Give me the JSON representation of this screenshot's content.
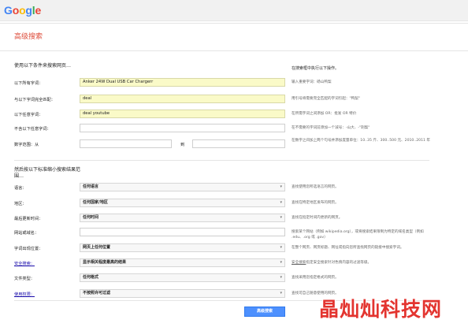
{
  "header": {
    "logo_letters": [
      {
        "ch": "G",
        "color": "#4285F4"
      },
      {
        "ch": "o",
        "color": "#EA4335"
      },
      {
        "ch": "o",
        "color": "#FBBC05"
      },
      {
        "ch": "g",
        "color": "#4285F4"
      },
      {
        "ch": "l",
        "color": "#34A853"
      },
      {
        "ch": "e",
        "color": "#EA4335"
      }
    ]
  },
  "page_title": "高级搜索",
  "section1": {
    "heading": "使用以下条件来搜索网页…",
    "hint_heading": "在搜索框中执行以下操作。",
    "rows": [
      {
        "label": "以下所有字词：",
        "value": "Anker 24W Dual USB Car Chargerr",
        "hint": "输入重要字词：砀山鸭梨"
      },
      {
        "label": "与以下字词完全匹配：",
        "value": "deal",
        "hint": "用引号将需要完全匹配的字词引起：\"鸭梨\""
      },
      {
        "label": "以下任意字词：",
        "value": "deal youtube",
        "hint": "在所需字词之间添加 OR：批发 OR 特价"
      },
      {
        "label": "不含以下任意字词：",
        "value": "",
        "hint": "在不需要的字词前添加一个减号：-山大、-\"刺梨\""
      }
    ],
    "range": {
      "label": "数字范围：从",
      "to": "到",
      "hint": "在数字之间加上两个句号并添加度量单位：10..35 斤、300..500 元、2010..2011 年"
    }
  },
  "section2": {
    "heading": "然后按以下标准缩小搜索结果范围…",
    "rows": [
      {
        "label": "语言：",
        "value": "任何语言",
        "hint": "查找使用您所选语言的网页。",
        "type": "select",
        "link": false
      },
      {
        "label": "地区：",
        "value": "任何国家/地区",
        "hint": "查找在特定地区发布的网页。",
        "type": "select",
        "link": false
      },
      {
        "label": "最后更新时间：",
        "value": "任何时间",
        "hint": "查找在指定时间内更新的网页。",
        "type": "select",
        "link": false
      },
      {
        "label": "网站或域名：",
        "value": "",
        "hint": "搜索某个网站（例如 wikipedia.org），或将搜索结果限制为特定的域名类型（例如 .edu、.org 或 .gov）",
        "type": "input",
        "link": false
      },
      {
        "label": "字词出现位置：",
        "value": "网页上任何位置",
        "hint": "在整个网页、网页标题、网址或指向您所查找网页的链接中搜索字词。",
        "type": "select",
        "link": false
      },
      {
        "label": "安全搜索：",
        "value": "显示相关程度最高的结果",
        "hint": "指定安全搜索针对色情内容的过滤等级。",
        "hint_link": "安全搜索",
        "type": "select",
        "link": true
      },
      {
        "label": "文件类型：",
        "value": "任何格式",
        "hint": "查找采用您指定格式的网页。",
        "type": "select",
        "link": false
      },
      {
        "label": "使用权限：",
        "value": "不按照许可过滤",
        "hint": "查找可自己随意使用的网页。",
        "type": "select",
        "link": true
      }
    ]
  },
  "submit_label": "高级搜索",
  "watermark": "晶灿灿科技网"
}
